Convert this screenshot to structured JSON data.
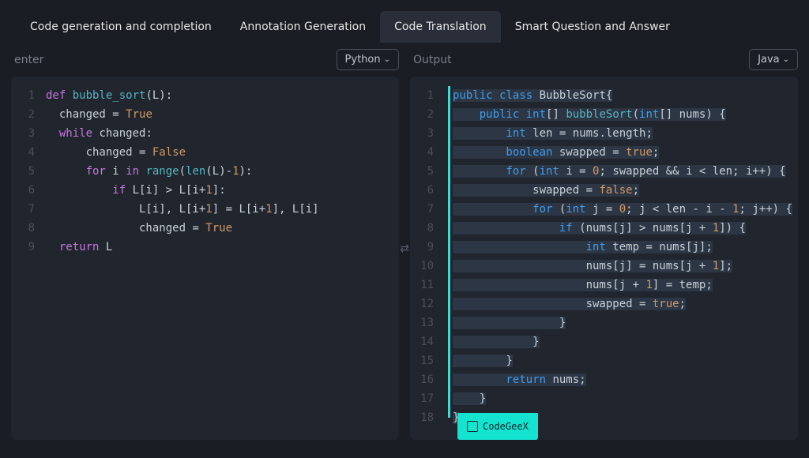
{
  "tabs": [
    {
      "label": "Code generation and completion",
      "active": false
    },
    {
      "label": "Annotation Generation",
      "active": false
    },
    {
      "label": "Code Translation",
      "active": true
    },
    {
      "label": "Smart Question and Answer",
      "active": false
    }
  ],
  "left": {
    "label": "enter",
    "lang": "Python",
    "code": [
      {
        "n": 1,
        "tokens": [
          [
            "kw",
            "def "
          ],
          [
            "fn",
            "bubble_sort"
          ],
          [
            "op",
            "(L):"
          ]
        ]
      },
      {
        "n": 2,
        "tokens": [
          [
            "id",
            "  changed "
          ],
          [
            "op",
            "= "
          ],
          [
            "bool",
            "True"
          ]
        ]
      },
      {
        "n": 3,
        "tokens": [
          [
            "kw",
            "  while "
          ],
          [
            "id",
            "changed"
          ],
          [
            "op",
            ":"
          ]
        ]
      },
      {
        "n": 4,
        "tokens": [
          [
            "id",
            "      changed "
          ],
          [
            "op",
            "= "
          ],
          [
            "bool",
            "False"
          ]
        ]
      },
      {
        "n": 5,
        "tokens": [
          [
            "kw",
            "      for "
          ],
          [
            "id",
            "i "
          ],
          [
            "kw",
            "in "
          ],
          [
            "fn",
            "range"
          ],
          [
            "op",
            "("
          ],
          [
            "fn",
            "len"
          ],
          [
            "op",
            "(L)-"
          ],
          [
            "lit",
            "1"
          ],
          [
            "op",
            "):"
          ]
        ]
      },
      {
        "n": 6,
        "tokens": [
          [
            "kw",
            "          if "
          ],
          [
            "id",
            "L[i] "
          ],
          [
            "op",
            "> "
          ],
          [
            "id",
            "L[i+"
          ],
          [
            "lit",
            "1"
          ],
          [
            "id",
            "]"
          ],
          [
            "op",
            ":"
          ]
        ]
      },
      {
        "n": 7,
        "tokens": [
          [
            "id",
            "              L[i], L[i+"
          ],
          [
            "lit",
            "1"
          ],
          [
            "id",
            "] "
          ],
          [
            "op",
            "= "
          ],
          [
            "id",
            "L[i+"
          ],
          [
            "lit",
            "1"
          ],
          [
            "id",
            "], L[i]"
          ]
        ]
      },
      {
        "n": 8,
        "tokens": [
          [
            "id",
            "              changed "
          ],
          [
            "op",
            "= "
          ],
          [
            "bool",
            "True"
          ]
        ]
      },
      {
        "n": 9,
        "tokens": [
          [
            "kw",
            "  return "
          ],
          [
            "id",
            "L"
          ]
        ]
      }
    ]
  },
  "right": {
    "label": "Output",
    "lang": "Java",
    "code": [
      {
        "n": 1,
        "hl": true,
        "tokens": [
          [
            "kw2",
            "public "
          ],
          [
            "kw2",
            "class "
          ],
          [
            "id",
            "BubbleSort"
          ],
          [
            "op",
            "{"
          ]
        ]
      },
      {
        "n": 2,
        "hl": true,
        "tokens": [
          [
            "kw2",
            "    public "
          ],
          [
            "kw2",
            "int"
          ],
          [
            "op",
            "[] "
          ],
          [
            "fn",
            "bubbleSort"
          ],
          [
            "op",
            "("
          ],
          [
            "kw2",
            "int"
          ],
          [
            "op",
            "[] "
          ],
          [
            "id",
            "nums"
          ],
          [
            "op",
            ") {"
          ]
        ]
      },
      {
        "n": 3,
        "hl": true,
        "tokens": [
          [
            "kw2",
            "        int "
          ],
          [
            "id",
            "len "
          ],
          [
            "op",
            "= "
          ],
          [
            "id",
            "nums.length"
          ],
          [
            "op",
            ";"
          ]
        ]
      },
      {
        "n": 4,
        "hl": true,
        "tokens": [
          [
            "kw2",
            "        boolean "
          ],
          [
            "id",
            "swapped "
          ],
          [
            "op",
            "= "
          ],
          [
            "bool",
            "true"
          ],
          [
            "op",
            ";"
          ]
        ]
      },
      {
        "n": 5,
        "hl": true,
        "tokens": [
          [
            "kw2",
            "        for "
          ],
          [
            "op",
            "("
          ],
          [
            "kw2",
            "int "
          ],
          [
            "id",
            "i "
          ],
          [
            "op",
            "= "
          ],
          [
            "lit",
            "0"
          ],
          [
            "op",
            "; "
          ],
          [
            "id",
            "swapped "
          ],
          [
            "op",
            "&& "
          ],
          [
            "id",
            "i "
          ],
          [
            "op",
            "< "
          ],
          [
            "id",
            "len"
          ],
          [
            "op",
            "; "
          ],
          [
            "id",
            "i++"
          ],
          [
            "op",
            ") {"
          ]
        ]
      },
      {
        "n": 6,
        "hl": true,
        "tokens": [
          [
            "id",
            "            swapped "
          ],
          [
            "op",
            "= "
          ],
          [
            "bool",
            "false"
          ],
          [
            "op",
            ";"
          ]
        ]
      },
      {
        "n": 7,
        "hl": true,
        "tokens": [
          [
            "kw2",
            "            for "
          ],
          [
            "op",
            "("
          ],
          [
            "kw2",
            "int "
          ],
          [
            "id",
            "j "
          ],
          [
            "op",
            "= "
          ],
          [
            "lit",
            "0"
          ],
          [
            "op",
            "; "
          ],
          [
            "id",
            "j "
          ],
          [
            "op",
            "< "
          ],
          [
            "id",
            "len "
          ],
          [
            "op",
            "- "
          ],
          [
            "id",
            "i "
          ],
          [
            "op",
            "- "
          ],
          [
            "lit",
            "1"
          ],
          [
            "op",
            "; "
          ],
          [
            "id",
            "j++"
          ],
          [
            "op",
            ") {"
          ]
        ]
      },
      {
        "n": 8,
        "hl": true,
        "tokens": [
          [
            "kw2",
            "                if "
          ],
          [
            "op",
            "("
          ],
          [
            "id",
            "nums[j] "
          ],
          [
            "op",
            "> "
          ],
          [
            "id",
            "nums[j "
          ],
          [
            "op",
            "+ "
          ],
          [
            "lit",
            "1"
          ],
          [
            "id",
            "]"
          ],
          [
            "op",
            ") {"
          ]
        ]
      },
      {
        "n": 9,
        "hl": true,
        "tokens": [
          [
            "kw2",
            "                    int "
          ],
          [
            "id",
            "temp "
          ],
          [
            "op",
            "= "
          ],
          [
            "id",
            "nums[j]"
          ],
          [
            "op",
            ";"
          ]
        ]
      },
      {
        "n": 10,
        "hl": true,
        "tokens": [
          [
            "id",
            "                    nums[j] "
          ],
          [
            "op",
            "= "
          ],
          [
            "id",
            "nums[j "
          ],
          [
            "op",
            "+ "
          ],
          [
            "lit",
            "1"
          ],
          [
            "id",
            "]"
          ],
          [
            "op",
            ";"
          ]
        ]
      },
      {
        "n": 11,
        "hl": true,
        "tokens": [
          [
            "id",
            "                    nums[j "
          ],
          [
            "op",
            "+ "
          ],
          [
            "lit",
            "1"
          ],
          [
            "id",
            "] "
          ],
          [
            "op",
            "= "
          ],
          [
            "id",
            "temp"
          ],
          [
            "op",
            ";"
          ]
        ]
      },
      {
        "n": 12,
        "hl": true,
        "tokens": [
          [
            "id",
            "                    swapped "
          ],
          [
            "op",
            "= "
          ],
          [
            "bool",
            "true"
          ],
          [
            "op",
            ";"
          ]
        ]
      },
      {
        "n": 13,
        "hl": true,
        "tokens": [
          [
            "op",
            "                }"
          ]
        ]
      },
      {
        "n": 14,
        "hl": true,
        "tokens": [
          [
            "op",
            "            }"
          ]
        ]
      },
      {
        "n": 15,
        "hl": true,
        "tokens": [
          [
            "op",
            "        }"
          ]
        ]
      },
      {
        "n": 16,
        "hl": true,
        "tokens": [
          [
            "kw2",
            "        return "
          ],
          [
            "id",
            "nums"
          ],
          [
            "op",
            ";"
          ]
        ]
      },
      {
        "n": 17,
        "hl": true,
        "tokens": [
          [
            "op",
            "    }"
          ]
        ]
      },
      {
        "n": 18,
        "hl": true,
        "tokens": [
          [
            "op",
            "}"
          ]
        ]
      }
    ]
  },
  "badge": "CodeGeeX"
}
